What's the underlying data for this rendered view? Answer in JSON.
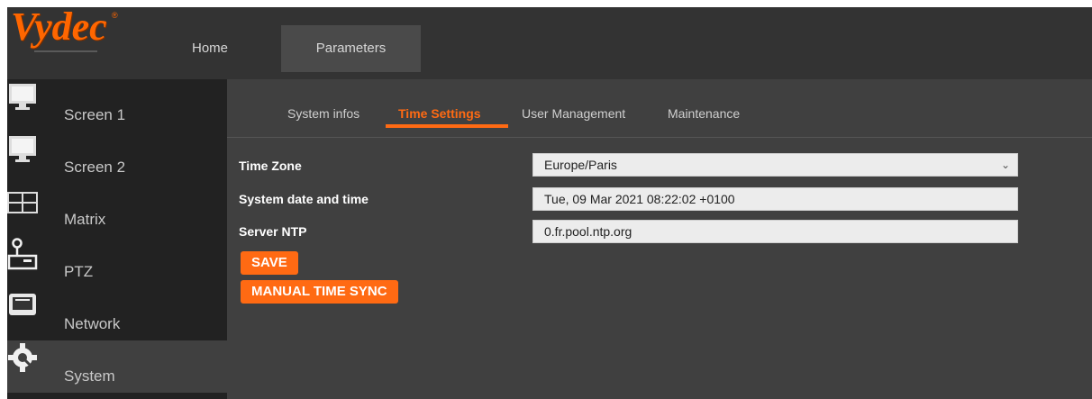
{
  "brand": {
    "logo_text": "Vydec",
    "registered": "®",
    "accent": "#ff6a13"
  },
  "topnav": {
    "home": "Home",
    "parameters": "Parameters"
  },
  "sidebar": {
    "items": [
      {
        "label": "Screen 1",
        "icon": "monitor-icon"
      },
      {
        "label": "Screen 2",
        "icon": "monitor-icon"
      },
      {
        "label": "Matrix",
        "icon": "matrix-grid-icon"
      },
      {
        "label": "PTZ",
        "icon": "joystick-icon"
      },
      {
        "label": "Network",
        "icon": "network-port-icon"
      },
      {
        "label": "System",
        "icon": "gear-wrench-icon"
      }
    ],
    "active": "System"
  },
  "tabs": {
    "items": [
      "System infos",
      "Time Settings",
      "User Management",
      "Maintenance"
    ],
    "active": "Time Settings"
  },
  "form": {
    "timezone_label": "Time Zone",
    "timezone_value": "Europe/Paris",
    "datetime_label": "System date and time",
    "datetime_value": "Tue, 09 Mar 2021 08:22:02 +0100",
    "ntp_label": "Server NTP",
    "ntp_value": "0.fr.pool.ntp.org"
  },
  "buttons": {
    "save": "SAVE",
    "manual_sync": "MANUAL TIME SYNC"
  }
}
